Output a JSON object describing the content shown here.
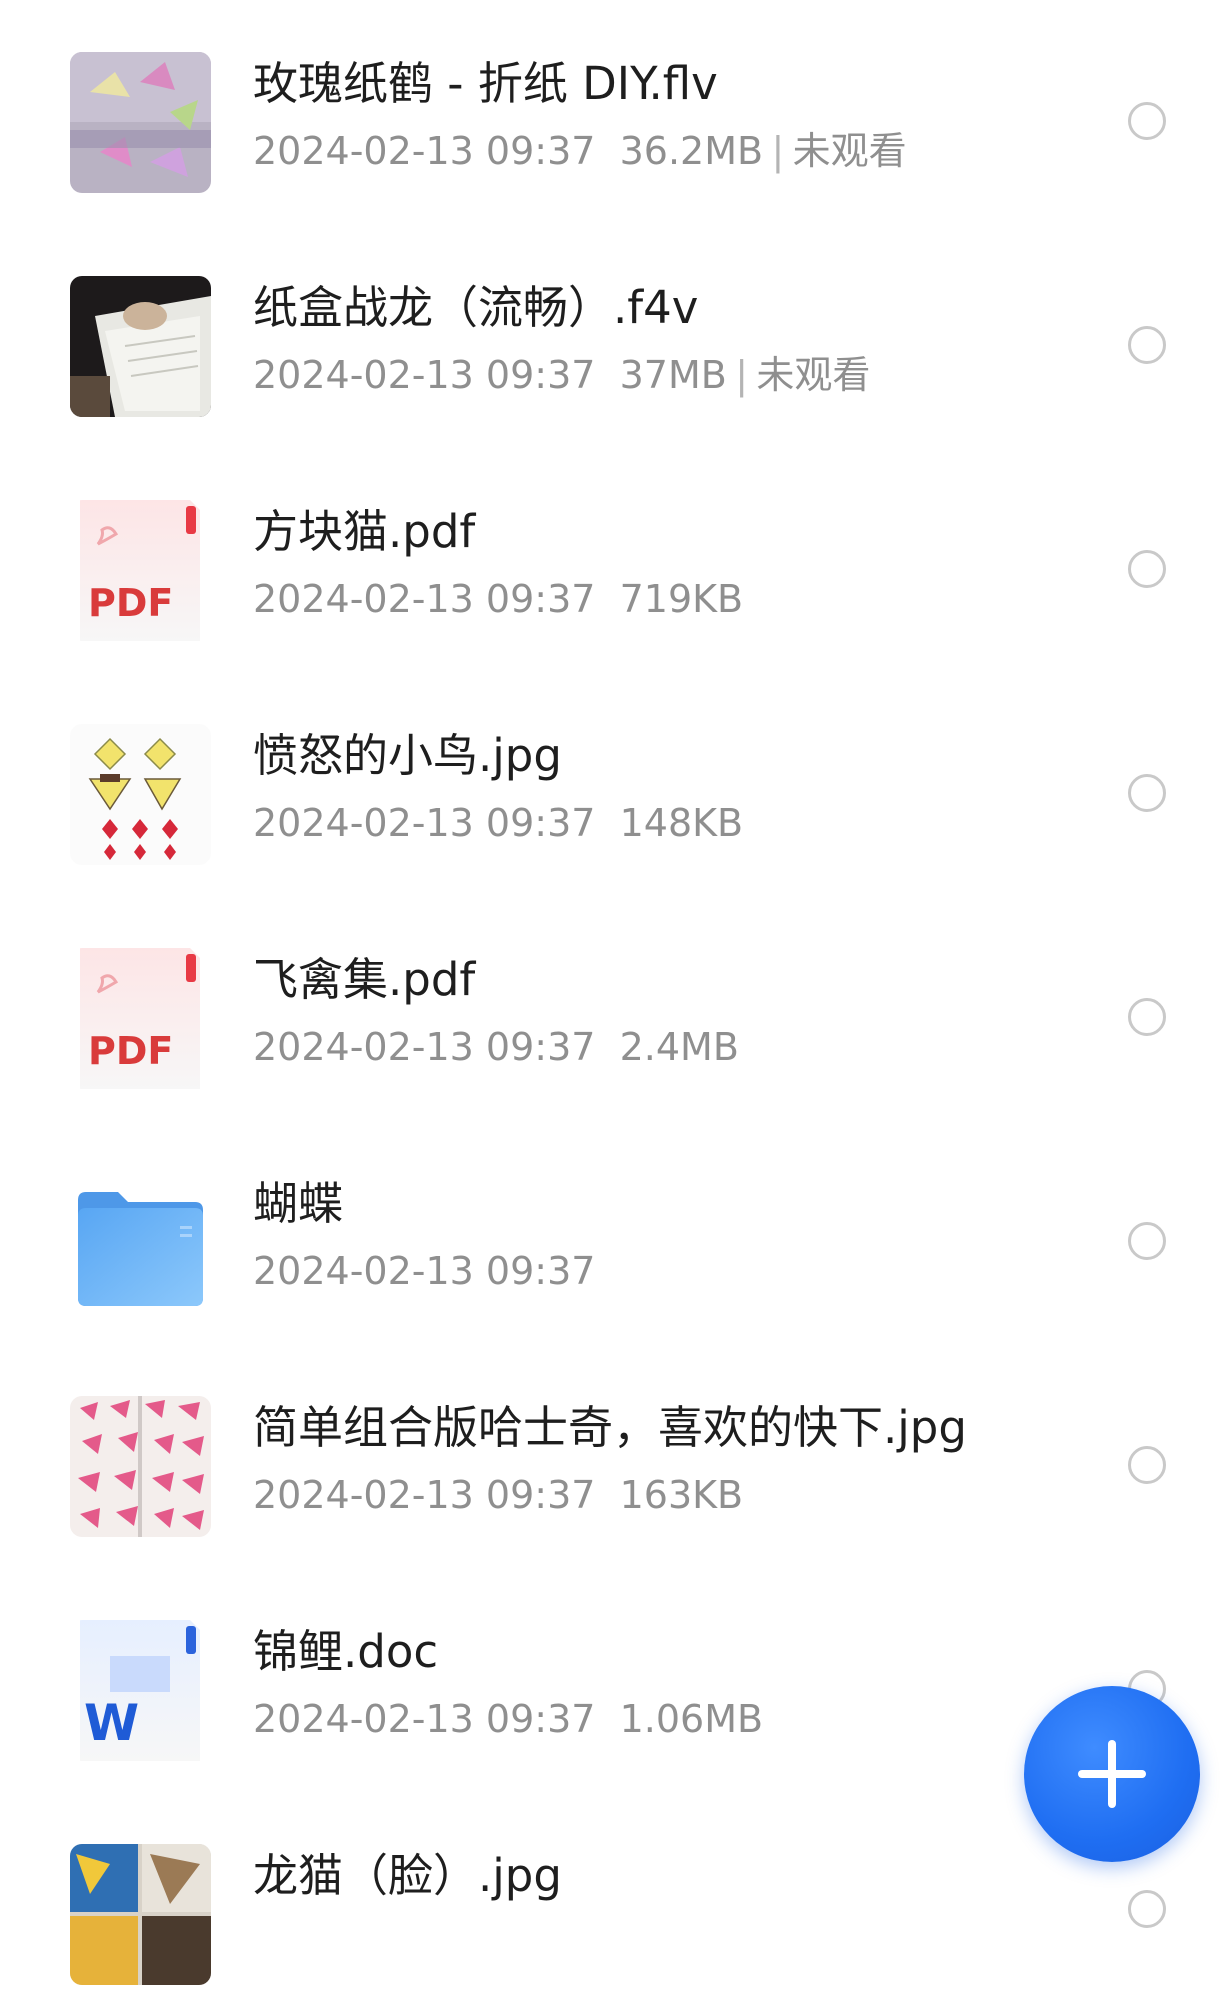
{
  "files": [
    {
      "name": "玫瑰纸鹤 - 折纸 DIY.flv",
      "date": "2024-02-13 09:37",
      "size": "36.2MB",
      "status": "未观看",
      "icon": "video-thumbnail-icon"
    },
    {
      "name": "纸盒战龙（流畅）.f4v",
      "date": "2024-02-13 09:37",
      "size": "37MB",
      "status": "未观看",
      "icon": "video-thumbnail-icon"
    },
    {
      "name": "方块猫.pdf",
      "date": "2024-02-13 09:37",
      "size": "719KB",
      "icon": "pdf-file-icon",
      "badge": "PDF"
    },
    {
      "name": "愤怒的小鸟.jpg",
      "date": "2024-02-13 09:37",
      "size": "148KB",
      "icon": "image-thumbnail-icon"
    },
    {
      "name": "飞禽集.pdf",
      "date": "2024-02-13 09:37",
      "size": "2.4MB",
      "icon": "pdf-file-icon",
      "badge": "PDF"
    },
    {
      "name": "蝴蝶",
      "date": "2024-02-13 09:37",
      "icon": "folder-icon"
    },
    {
      "name": "简单组合版哈士奇，喜欢的快下.jpg",
      "date": "2024-02-13 09:37",
      "size": "163KB",
      "icon": "image-thumbnail-icon"
    },
    {
      "name": "锦鲤.doc",
      "date": "2024-02-13 09:37",
      "size": "1.06MB",
      "icon": "word-file-icon",
      "badge": "W"
    },
    {
      "name": "龙猫（脸）.jpg",
      "icon": "image-thumbnail-icon"
    }
  ],
  "fab": {
    "icon": "plus-icon"
  },
  "colors": {
    "accent": "#1f6ef2",
    "pdf_red": "#d93b3b",
    "word_blue": "#1f5bd6",
    "folder_blue": "#6cb4f5"
  }
}
